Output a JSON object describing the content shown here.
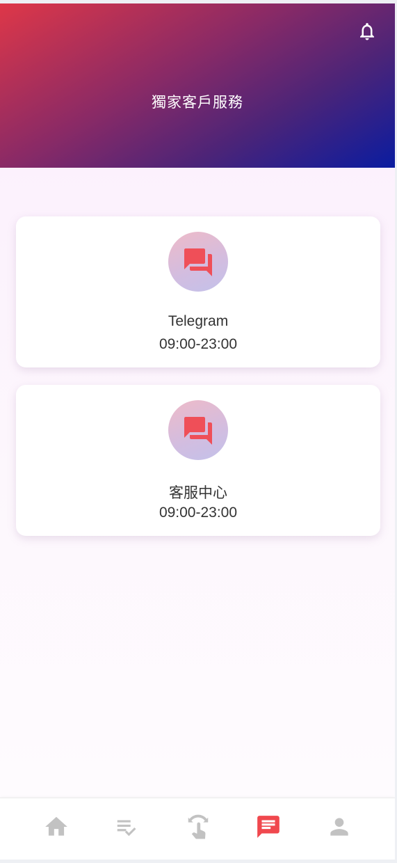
{
  "header": {
    "title": "獨家客戶服務",
    "gradient_colors": [
      "#de3748",
      "#0a1ca0"
    ]
  },
  "notification": {
    "icon": "bell-icon"
  },
  "services": [
    {
      "name": "Telegram",
      "hours": "09:00-23:00",
      "icon": "chat-bubbles-icon"
    },
    {
      "name": "客服中心",
      "hours": "09:00-23:00",
      "icon": "chat-bubbles-icon"
    }
  ],
  "bottom_nav": {
    "active_index": 3,
    "active_color": "#f0484e",
    "inactive_color": "#c2c2c2",
    "items": [
      {
        "icon": "home-icon"
      },
      {
        "icon": "task-list-icon"
      },
      {
        "icon": "swipe-icon"
      },
      {
        "icon": "message-icon"
      },
      {
        "icon": "profile-icon"
      }
    ]
  }
}
